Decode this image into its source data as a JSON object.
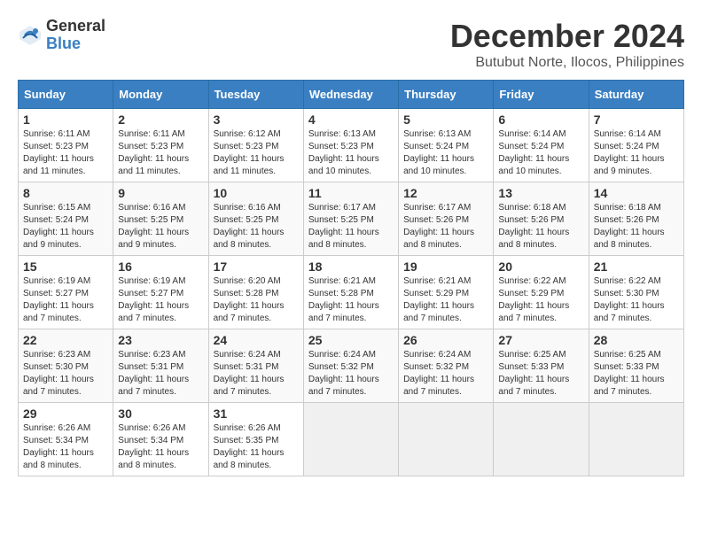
{
  "logo": {
    "line1": "General",
    "line2": "Blue"
  },
  "title": "December 2024",
  "subtitle": "Butubut Norte, Ilocos, Philippines",
  "days_of_week": [
    "Sunday",
    "Monday",
    "Tuesday",
    "Wednesday",
    "Thursday",
    "Friday",
    "Saturday"
  ],
  "weeks": [
    [
      {
        "day": "1",
        "rise": "6:11 AM",
        "set": "5:23 PM",
        "daylight": "11 hours and 11 minutes."
      },
      {
        "day": "2",
        "rise": "6:11 AM",
        "set": "5:23 PM",
        "daylight": "11 hours and 11 minutes."
      },
      {
        "day": "3",
        "rise": "6:12 AM",
        "set": "5:23 PM",
        "daylight": "11 hours and 11 minutes."
      },
      {
        "day": "4",
        "rise": "6:13 AM",
        "set": "5:23 PM",
        "daylight": "11 hours and 10 minutes."
      },
      {
        "day": "5",
        "rise": "6:13 AM",
        "set": "5:24 PM",
        "daylight": "11 hours and 10 minutes."
      },
      {
        "day": "6",
        "rise": "6:14 AM",
        "set": "5:24 PM",
        "daylight": "11 hours and 10 minutes."
      },
      {
        "day": "7",
        "rise": "6:14 AM",
        "set": "5:24 PM",
        "daylight": "11 hours and 9 minutes."
      }
    ],
    [
      {
        "day": "8",
        "rise": "6:15 AM",
        "set": "5:24 PM",
        "daylight": "11 hours and 9 minutes."
      },
      {
        "day": "9",
        "rise": "6:16 AM",
        "set": "5:25 PM",
        "daylight": "11 hours and 9 minutes."
      },
      {
        "day": "10",
        "rise": "6:16 AM",
        "set": "5:25 PM",
        "daylight": "11 hours and 8 minutes."
      },
      {
        "day": "11",
        "rise": "6:17 AM",
        "set": "5:25 PM",
        "daylight": "11 hours and 8 minutes."
      },
      {
        "day": "12",
        "rise": "6:17 AM",
        "set": "5:26 PM",
        "daylight": "11 hours and 8 minutes."
      },
      {
        "day": "13",
        "rise": "6:18 AM",
        "set": "5:26 PM",
        "daylight": "11 hours and 8 minutes."
      },
      {
        "day": "14",
        "rise": "6:18 AM",
        "set": "5:26 PM",
        "daylight": "11 hours and 8 minutes."
      }
    ],
    [
      {
        "day": "15",
        "rise": "6:19 AM",
        "set": "5:27 PM",
        "daylight": "11 hours and 7 minutes."
      },
      {
        "day": "16",
        "rise": "6:19 AM",
        "set": "5:27 PM",
        "daylight": "11 hours and 7 minutes."
      },
      {
        "day": "17",
        "rise": "6:20 AM",
        "set": "5:28 PM",
        "daylight": "11 hours and 7 minutes."
      },
      {
        "day": "18",
        "rise": "6:21 AM",
        "set": "5:28 PM",
        "daylight": "11 hours and 7 minutes."
      },
      {
        "day": "19",
        "rise": "6:21 AM",
        "set": "5:29 PM",
        "daylight": "11 hours and 7 minutes."
      },
      {
        "day": "20",
        "rise": "6:22 AM",
        "set": "5:29 PM",
        "daylight": "11 hours and 7 minutes."
      },
      {
        "day": "21",
        "rise": "6:22 AM",
        "set": "5:30 PM",
        "daylight": "11 hours and 7 minutes."
      }
    ],
    [
      {
        "day": "22",
        "rise": "6:23 AM",
        "set": "5:30 PM",
        "daylight": "11 hours and 7 minutes."
      },
      {
        "day": "23",
        "rise": "6:23 AM",
        "set": "5:31 PM",
        "daylight": "11 hours and 7 minutes."
      },
      {
        "day": "24",
        "rise": "6:24 AM",
        "set": "5:31 PM",
        "daylight": "11 hours and 7 minutes."
      },
      {
        "day": "25",
        "rise": "6:24 AM",
        "set": "5:32 PM",
        "daylight": "11 hours and 7 minutes."
      },
      {
        "day": "26",
        "rise": "6:24 AM",
        "set": "5:32 PM",
        "daylight": "11 hours and 7 minutes."
      },
      {
        "day": "27",
        "rise": "6:25 AM",
        "set": "5:33 PM",
        "daylight": "11 hours and 7 minutes."
      },
      {
        "day": "28",
        "rise": "6:25 AM",
        "set": "5:33 PM",
        "daylight": "11 hours and 7 minutes."
      }
    ],
    [
      {
        "day": "29",
        "rise": "6:26 AM",
        "set": "5:34 PM",
        "daylight": "11 hours and 8 minutes."
      },
      {
        "day": "30",
        "rise": "6:26 AM",
        "set": "5:34 PM",
        "daylight": "11 hours and 8 minutes."
      },
      {
        "day": "31",
        "rise": "6:26 AM",
        "set": "5:35 PM",
        "daylight": "11 hours and 8 minutes."
      },
      null,
      null,
      null,
      null
    ]
  ],
  "labels": {
    "sunrise": "Sunrise:",
    "sunset": "Sunset:",
    "daylight": "Daylight hours"
  }
}
